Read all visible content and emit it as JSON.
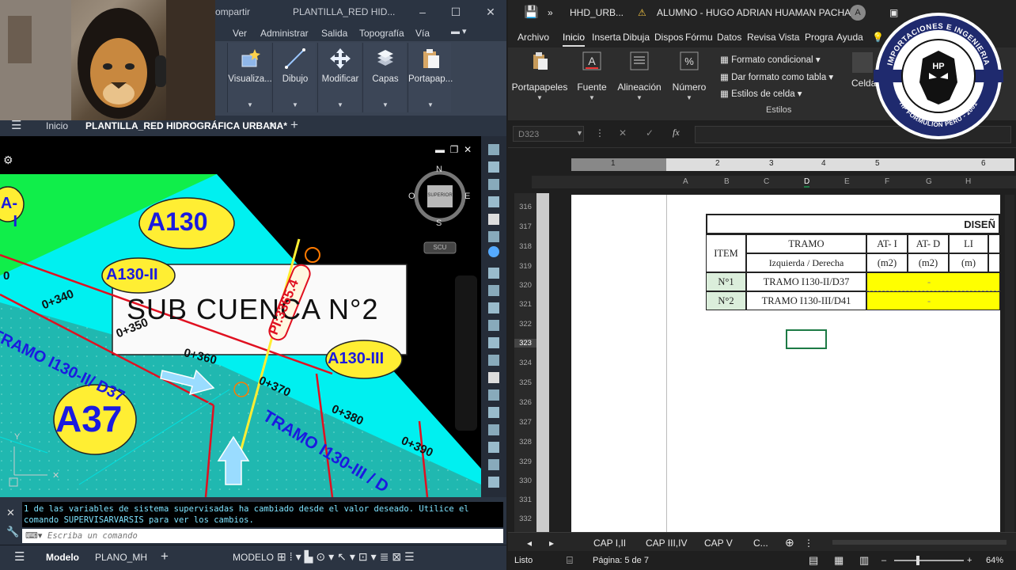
{
  "cad": {
    "title": {
      "share": "ompartir",
      "doc": "PLANTILLA_RED HID..."
    },
    "menu": [
      "Ver",
      "Administrar",
      "Salida",
      "Topografía",
      "Vía"
    ],
    "ribbon": [
      {
        "label": "Visualiza...",
        "icon": "visualize-icon"
      },
      {
        "label": "Dibujo",
        "icon": "draw-line-icon"
      },
      {
        "label": "Modificar",
        "icon": "move-icon"
      },
      {
        "label": "Capas",
        "icon": "layers-icon"
      },
      {
        "label": "Portapap...",
        "icon": "clipboard-icon"
      }
    ],
    "tabs": {
      "home": "Inicio",
      "active": "PLANTILLA_RED HIDROGRÁFICA URBANA*"
    },
    "viewcube": {
      "n": "N",
      "s": "S",
      "e": "E",
      "o": "O",
      "face": "SUPERIOR",
      "ucs": "SCU"
    },
    "drawing": {
      "labels": {
        "a130": "A130",
        "a130ii": "A130-II",
        "a130iii": "A130-III",
        "a37": "A37",
        "a_i": "A-I",
        "subcuenca": "SUB CUENCA N°2",
        "pi": "PI:3365.4",
        "tramo1": "TRAMO I130-II/ D37",
        "tramo2": "TRAMO I130-III / D",
        "ch340": "0+340",
        "ch350": "0+350",
        "ch360": "0+360",
        "ch370": "0+370",
        "ch380": "0+380",
        "ch390": "0+390",
        "ch0": "0"
      }
    },
    "command": {
      "message": "1 de las variables de sistema supervisadas ha cambiado desde el valor deseado. Utilice el\ncomando SUPERVISARVARSIS para ver los cambios.",
      "placeholder": "Escriba un comando"
    },
    "status": {
      "modelo_tab": "Modelo",
      "layout_tab": "PLANO_MH",
      "space": "MODELO"
    }
  },
  "excel": {
    "title": {
      "file": "HHD_URB...",
      "user": "ALUMNO - HUGO ADRIAN HUAMAN PACHARI",
      "avatar": "A"
    },
    "tabs": [
      "Archivo",
      "Inicio",
      "Inserta",
      "Dibuja",
      "Dispos",
      "Fórmu",
      "Datos",
      "Revisa",
      "Vista",
      "Progra",
      "Ayuda"
    ],
    "ribbon": [
      {
        "label": "Portapapeles",
        "icon": "clipboard-icon"
      },
      {
        "label": "Fuente",
        "icon": "font-icon"
      },
      {
        "label": "Alineación",
        "icon": "align-icon"
      },
      {
        "label": "Número",
        "icon": "percent-icon"
      }
    ],
    "styles": {
      "conditional": "Formato condicional",
      "as_table": "Dar formato como tabla",
      "cell_styles": "Estilos de celda",
      "group": "Estilos",
      "celda": "Celda"
    },
    "namebox": "D323",
    "columns": [
      "A",
      "B",
      "C",
      "D",
      "E",
      "F",
      "G",
      "H"
    ],
    "ruler": [
      "1",
      "2",
      "3",
      "4",
      "5",
      "6"
    ],
    "rows": [
      "316",
      "317",
      "318",
      "319",
      "320",
      "321",
      "322",
      "323",
      "324",
      "325",
      "326",
      "327",
      "328",
      "329",
      "330",
      "331",
      "332"
    ],
    "table": {
      "title": "DISEÑ",
      "item": "ITEM",
      "tramo": "TRAMO",
      "izq_der": "Izquierda / Derecha",
      "at_i": "AT- I",
      "at_d": "AT- D",
      "li": "LI",
      "m2a": "(m2)",
      "m2b": "(m2)",
      "m": "(m)",
      "row1_no": "N°1",
      "row1_tramo": "TRAMO I130-II/D37",
      "row2_no": "N°2",
      "row2_tramo": "TRAMO I130-III/D41",
      "dash": "-"
    },
    "sheets": [
      "CAP I,II",
      "CAP III,IV",
      "CAP V",
      "C..."
    ],
    "status": {
      "mode": "Listo",
      "page": "Página: 5 de 7",
      "zoom": "64%"
    }
  },
  "logo": {
    "top": "IMPORTACIONES E INGENIERIA",
    "bottom": "HP FORMULION PERÚ - 2001",
    "mid": "HP"
  },
  "colors": {
    "cyan": "#00ffff",
    "green": "#00ff3c",
    "yellow": "#ffee33",
    "blue_text": "#1a1ae0",
    "red": "#e01020",
    "cell_yellow": "#ffff00",
    "cell_green": "#dbeedb"
  }
}
